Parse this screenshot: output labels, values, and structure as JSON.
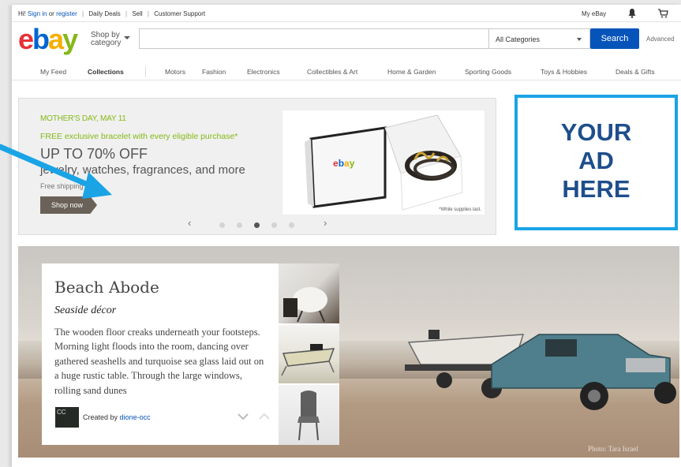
{
  "topbar": {
    "greeting": "Hi!",
    "sign_in": "Sign in",
    "or": "or",
    "register": "register",
    "daily_deals": "Daily Deals",
    "sell": "Sell",
    "customer_support": "Customer Support",
    "my_ebay": "My eBay",
    "bell_icon": "bell-icon",
    "cart_icon": "cart-icon"
  },
  "header": {
    "logo": [
      "e",
      "b",
      "a",
      "y"
    ],
    "brand_colors": [
      "#e53238",
      "#0064d2",
      "#f5af02",
      "#86b817"
    ],
    "shop_by_1": "Shop by",
    "shop_by_2": "category",
    "search_value": "",
    "category_selected": "All Categories",
    "search_button": "Search",
    "advanced": "Advanced"
  },
  "catnav": {
    "items": [
      "My Feed",
      "Collections",
      "Motors",
      "Fashion",
      "Electronics",
      "Collectibles & Art",
      "Home & Garden",
      "Sporting Goods",
      "Toys & Hobbies",
      "Deals & Gifts"
    ],
    "active": "Collections"
  },
  "promo": {
    "date": "MOTHER'S DAY, MAY 11",
    "offer": "FREE exclusive bracelet with every eligible purchase*",
    "headline": "UP TO 70% OFF",
    "subline": "jewelry, watches, fragrances, and more",
    "shipping": "Free shipping",
    "shop_now": "Shop now",
    "box_logo": "ebay",
    "fine_print": "*While supplies last.",
    "prev": "‹",
    "next": "›",
    "slides": 5,
    "active_slide": 3
  },
  "ad": {
    "lines": [
      "YOUR",
      "AD",
      "HERE"
    ],
    "border_color": "#1aa4e6",
    "text_color": "#1f4e8c"
  },
  "collection": {
    "title": "Beach Abode",
    "subtitle": "Seaside décor",
    "description": "The wooden floor creaks underneath your footsteps. Morning light floods into the room, dancing over gathered seashells and turquoise sea glass laid out on a huge rustic table. Through the large windows, rolling sand dunes",
    "avatar_text": "CC",
    "created_by": "Created by",
    "creator": "dione-occ",
    "photo_credit": "Photo: Tara Israel"
  }
}
